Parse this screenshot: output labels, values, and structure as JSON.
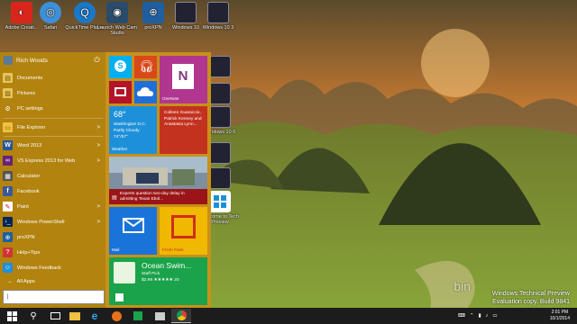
{
  "desktop": {
    "icons_top": [
      {
        "label": "Adobe Creati...",
        "icon": "adobe-cc-icon"
      },
      {
        "label": "Safari",
        "icon": "safari-icon"
      },
      {
        "label": "QuickTime Player",
        "icon": "quicktime-icon"
      },
      {
        "label": "Launch Web Cam Studio",
        "icon": "webcam-icon"
      },
      {
        "label": "proXPN",
        "icon": "proxpn-icon"
      },
      {
        "label": "Windows 10",
        "icon": "screenshot-icon"
      },
      {
        "label": "Windows 10 3",
        "icon": "screenshot-icon"
      }
    ],
    "icons_right": [
      {
        "label": "",
        "icon": "screenshot-icon"
      },
      {
        "label": "",
        "icon": "screenshot-icon"
      },
      {
        "label": "Windows 10 6",
        "icon": "screenshot-icon"
      },
      {
        "label": "",
        "icon": "screenshot-icon"
      },
      {
        "label": "",
        "icon": "screenshot-icon"
      },
      {
        "label": "Welcome to Tech Preview",
        "icon": "windows-icon"
      }
    ]
  },
  "start_menu": {
    "user_name": "Rich Woods",
    "places": [
      {
        "label": "Documents",
        "icon": "documents-icon"
      },
      {
        "label": "Pictures",
        "icon": "pictures-icon"
      },
      {
        "label": "PC settings",
        "icon": "settings-icon"
      }
    ],
    "apps": [
      {
        "label": "File Explorer",
        "icon": "file-explorer-icon",
        "arrow": ">"
      },
      {
        "label": "Word 2013",
        "icon": "word-icon",
        "arrow": ">"
      },
      {
        "label": "VS Express 2013 for Web",
        "icon": "vs-icon",
        "arrow": ">"
      },
      {
        "label": "Calculator",
        "icon": "calculator-icon",
        "arrow": ""
      },
      {
        "label": "Facebook",
        "icon": "facebook-icon",
        "arrow": ""
      },
      {
        "label": "Paint",
        "icon": "paint-icon",
        "arrow": ">"
      },
      {
        "label": "Windows PowerShell",
        "icon": "powershell-icon",
        "arrow": ">"
      },
      {
        "label": "proXPN",
        "icon": "proxpn-icon",
        "arrow": ""
      },
      {
        "label": "Help+Tips",
        "icon": "help-icon",
        "arrow": ""
      },
      {
        "label": "Windows Feedback",
        "icon": "feedback-icon",
        "arrow": ""
      }
    ],
    "all_apps_label": "All Apps",
    "search_value": "|",
    "tiles": {
      "onenote_label": "OneNote",
      "weather_temp": "68°",
      "weather_city": "Washington D.C.",
      "weather_cond": "Partly Cloudy",
      "weather_range": "74°/57°",
      "weather_label": "Weather",
      "people_text": "Colleen Guaraccio, Patrick Kenney and Anastasia Lynn...",
      "news_text": "Experts question two-day delay in admitting Texas Ebol...",
      "mail_label": "Mail",
      "freshpaint_label": "Fresh Paint",
      "store_title": "Ocean Swim...",
      "store_sub": "Staff Pick",
      "store_price": "$2.99 ★★★★★ 20"
    }
  },
  "taskbar": {
    "clock_time": "2:01 PM",
    "clock_date": "10/1/2014"
  },
  "watermark": {
    "line1": "Windows Technical Preview",
    "line2": "Evaluation copy. Build 9841",
    "bing": "bin"
  }
}
